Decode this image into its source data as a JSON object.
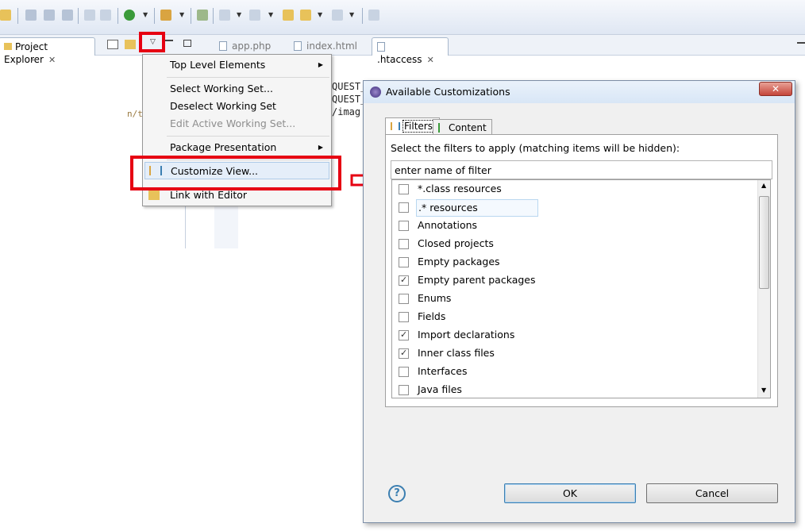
{
  "workbench": {
    "view_tab": {
      "label": "Project Explorer"
    },
    "editor_tabs": [
      {
        "label": "app.php"
      },
      {
        "label": "index.html"
      },
      {
        "label": ".htaccess"
      }
    ],
    "code_fragments": [
      "QUEST_",
      "QUEST_",
      "/imag",
      "n/t"
    ]
  },
  "menu": {
    "items": [
      {
        "label": "Top Level Elements",
        "submenu": true,
        "disabled": false
      },
      {
        "label": "Select Working Set...",
        "submenu": false,
        "disabled": false
      },
      {
        "label": "Deselect Working Set",
        "submenu": false,
        "disabled": false
      },
      {
        "label": "Edit Active Working Set...",
        "submenu": false,
        "disabled": true
      },
      {
        "label": "Package Presentation",
        "submenu": true,
        "disabled": false
      },
      {
        "label": "Customize View...",
        "submenu": false,
        "disabled": false
      },
      {
        "label": "Link with Editor",
        "submenu": false,
        "disabled": false
      }
    ]
  },
  "dialog": {
    "title": "Available Customizations",
    "tabs": [
      {
        "label": "Filters"
      },
      {
        "label": "Content"
      }
    ],
    "instruction": "Select the filters to apply (matching items will be hidden):",
    "filter_input": {
      "value": "enter name of filter"
    },
    "filters": [
      {
        "label": "*.class resources",
        "checked": false
      },
      {
        "label": ".* resources",
        "checked": false
      },
      {
        "label": "Annotations",
        "checked": false
      },
      {
        "label": "Closed projects",
        "checked": false
      },
      {
        "label": "Empty packages",
        "checked": false
      },
      {
        "label": "Empty parent packages",
        "checked": true
      },
      {
        "label": "Enums",
        "checked": false
      },
      {
        "label": "Fields",
        "checked": false
      },
      {
        "label": "Import declarations",
        "checked": true
      },
      {
        "label": "Inner class files",
        "checked": true
      },
      {
        "label": "Interfaces",
        "checked": false
      },
      {
        "label": "Java files",
        "checked": false
      }
    ],
    "ok_label": "OK",
    "cancel_label": "Cancel",
    "help_icon": "?"
  },
  "colors": {
    "highlight_red": "#e60012",
    "accent_blue": "#3c7fb1"
  }
}
